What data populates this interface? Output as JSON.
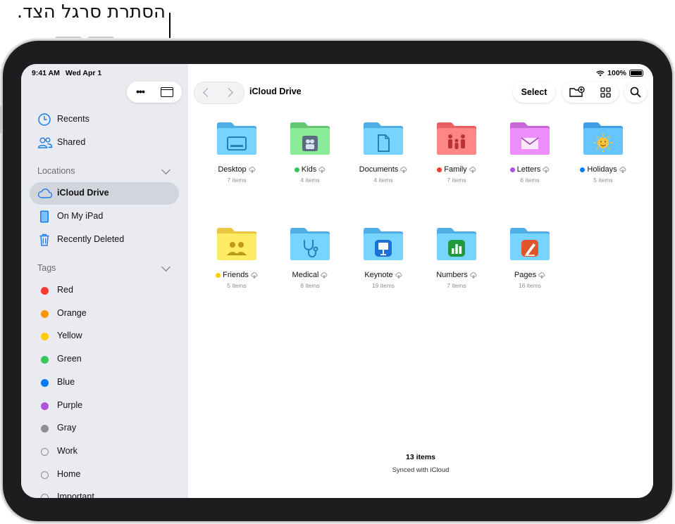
{
  "callout": {
    "text": "הסתרת סרגל הצד."
  },
  "status": {
    "time": "9:41 AM",
    "date": "Wed Apr 1",
    "battery": "100%"
  },
  "sidebar": {
    "top_items": [
      {
        "label": "Recents",
        "icon": "clock-icon"
      },
      {
        "label": "Shared",
        "icon": "people-icon"
      }
    ],
    "locations_header": "Locations",
    "locations": [
      {
        "label": "iCloud Drive",
        "icon": "cloud-icon",
        "selected": true
      },
      {
        "label": "On My iPad",
        "icon": "ipad-icon"
      },
      {
        "label": "Recently Deleted",
        "icon": "trash-icon"
      }
    ],
    "tags_header": "Tags",
    "tags": [
      {
        "label": "Red",
        "color": "#ff3b30"
      },
      {
        "label": "Orange",
        "color": "#ff9500"
      },
      {
        "label": "Yellow",
        "color": "#ffcc00"
      },
      {
        "label": "Green",
        "color": "#34c759"
      },
      {
        "label": "Blue",
        "color": "#007aff"
      },
      {
        "label": "Purple",
        "color": "#af52de"
      },
      {
        "label": "Gray",
        "color": "#8e8e93"
      },
      {
        "label": "Work",
        "color": ""
      },
      {
        "label": "Home",
        "color": ""
      },
      {
        "label": "Important",
        "color": ""
      }
    ]
  },
  "toolbar": {
    "title": "iCloud Drive",
    "select_label": "Select"
  },
  "folders": [
    {
      "name": "Desktop",
      "count": "7 items",
      "tag": "",
      "color": "#5ab8f0",
      "glyph": "desktop"
    },
    {
      "name": "Kids",
      "count": "4 items",
      "tag": "#34c759",
      "color": "#6fcf7c",
      "glyph": "kids"
    },
    {
      "name": "Documents",
      "count": "4 items",
      "tag": "",
      "color": "#5ab8f0",
      "glyph": "doc"
    },
    {
      "name": "Family",
      "count": "7 items",
      "tag": "#ff3b30",
      "color": "#f26a6a",
      "glyph": "family"
    },
    {
      "name": "Letters",
      "count": "6 items",
      "tag": "#af52de",
      "color": "#d272e0",
      "glyph": "letter"
    },
    {
      "name": "Holidays",
      "count": "5 items",
      "tag": "#007aff",
      "color": "#4aa8f0",
      "glyph": "sun"
    },
    {
      "name": "Friends",
      "count": "5 items",
      "tag": "#ffcc00",
      "color": "#f5d04a",
      "glyph": "friends"
    },
    {
      "name": "Medical",
      "count": "8 items",
      "tag": "",
      "color": "#5ab8f0",
      "glyph": "stetho"
    },
    {
      "name": "Keynote",
      "count": "19 items",
      "tag": "",
      "color": "#5ab8f0",
      "glyph": "keynote"
    },
    {
      "name": "Numbers",
      "count": "7 items",
      "tag": "",
      "color": "#5ab8f0",
      "glyph": "numbers"
    },
    {
      "name": "Pages",
      "count": "16 items",
      "tag": "",
      "color": "#5ab8f0",
      "glyph": "pages"
    }
  ],
  "footer": {
    "count": "13 items",
    "sync": "Synced with iCloud"
  }
}
